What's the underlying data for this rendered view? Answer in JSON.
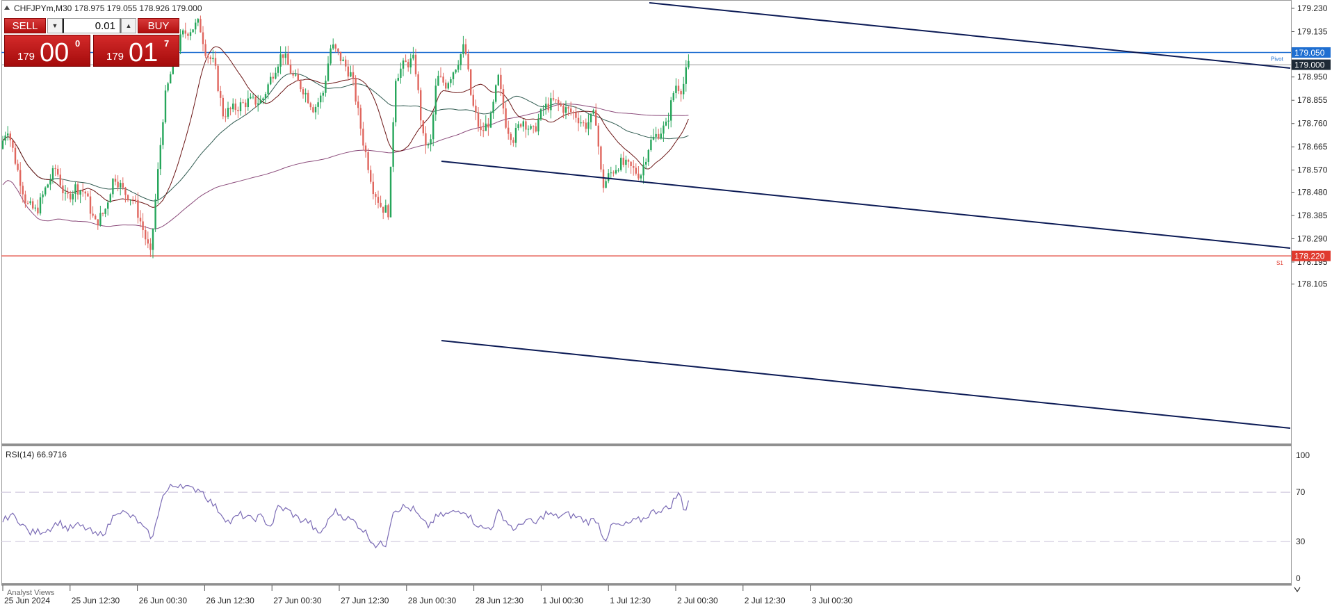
{
  "header": {
    "symbol_tf": "CHFJPYm,M30",
    "ohlc": "178.975 179.055 178.926 179.000"
  },
  "trade_panel": {
    "sell_label": "SELL",
    "buy_label": "BUY",
    "lot_value": "0.01",
    "sell_price_prefix": "179",
    "sell_price_main": "00",
    "sell_price_sup": "0",
    "buy_price_prefix": "179",
    "buy_price_main": "01",
    "buy_price_sup": "7"
  },
  "price_axis": {
    "ticks": [
      "179.230",
      "179.135",
      "178.950",
      "178.855",
      "178.760",
      "178.665",
      "178.570",
      "178.480",
      "178.385",
      "178.290",
      "178.195",
      "178.105"
    ],
    "tick_values": [
      179.23,
      179.135,
      178.95,
      178.855,
      178.76,
      178.665,
      178.57,
      178.48,
      178.385,
      178.29,
      178.195,
      178.105
    ],
    "pivot_label": "179.050",
    "pivot_text": "Pivot",
    "current_label": "179.000",
    "s1_label": "178.220",
    "s1_text": "S1",
    "pivot_color": "#1f6fd1",
    "s1_color": "#e03a2e",
    "current_bg": "#1e2a36"
  },
  "rsi": {
    "label": "RSI(14) 66.9716",
    "levels": [
      "100",
      "70",
      "30",
      "0"
    ],
    "line_color": "#7b6bb5"
  },
  "time_axis": {
    "labels": [
      "25 Jun 2024",
      "25 Jun 12:30",
      "26 Jun 00:30",
      "26 Jun 12:30",
      "27 Jun 00:30",
      "27 Jun 12:30",
      "28 Jun 00:30",
      "28 Jun 12:30",
      "1 Jul 00:30",
      "1 Jul 12:30",
      "2 Jul 00:30",
      "2 Jul 12:30",
      "3 Jul 00:30"
    ]
  },
  "bottom_tab": "Analyst Views",
  "colors": {
    "bull": "#26a65b",
    "bear": "#e0665e",
    "channel": "#0b1a55",
    "ma_fast": "#6b1515",
    "ma_mid": "#2f5a50",
    "ma_slow": "#8a4a7a"
  },
  "chart_data": {
    "type": "candlestick",
    "instrument": "CHFJPYm",
    "timeframe": "M30",
    "ylim": [
      178.08,
      179.25
    ],
    "close_path": [
      [
        0,
        178.62
      ],
      [
        14,
        178.75
      ],
      [
        28,
        178.58
      ],
      [
        42,
        178.43
      ],
      [
        56,
        178.4
      ],
      [
        70,
        178.5
      ],
      [
        84,
        178.58
      ],
      [
        98,
        178.45
      ],
      [
        112,
        178.5
      ],
      [
        126,
        178.48
      ],
      [
        140,
        178.35
      ],
      [
        154,
        178.4
      ],
      [
        168,
        178.55
      ],
      [
        182,
        178.48
      ],
      [
        196,
        178.45
      ],
      [
        210,
        178.32
      ],
      [
        220,
        178.22
      ],
      [
        232,
        178.6
      ],
      [
        240,
        178.85
      ],
      [
        252,
        179.0
      ],
      [
        265,
        179.12
      ],
      [
        280,
        179.15
      ],
      [
        290,
        179.17
      ],
      [
        300,
        179.05
      ],
      [
        312,
        179.0
      ],
      [
        324,
        178.8
      ],
      [
        340,
        178.82
      ],
      [
        360,
        178.85
      ],
      [
        380,
        178.85
      ],
      [
        398,
        178.98
      ],
      [
        410,
        179.05
      ],
      [
        425,
        178.95
      ],
      [
        440,
        178.9
      ],
      [
        455,
        178.82
      ],
      [
        468,
        178.88
      ],
      [
        480,
        179.08
      ],
      [
        495,
        179.02
      ],
      [
        510,
        178.95
      ],
      [
        525,
        178.7
      ],
      [
        540,
        178.5
      ],
      [
        552,
        178.42
      ],
      [
        563,
        178.4
      ],
      [
        572,
        178.95
      ],
      [
        585,
        179.0
      ],
      [
        600,
        179.02
      ],
      [
        612,
        178.7
      ],
      [
        622,
        178.65
      ],
      [
        632,
        178.95
      ],
      [
        645,
        178.92
      ],
      [
        660,
        179.0
      ],
      [
        672,
        179.08
      ],
      [
        682,
        178.85
      ],
      [
        695,
        178.72
      ],
      [
        710,
        178.78
      ],
      [
        720,
        178.95
      ],
      [
        732,
        178.75
      ],
      [
        742,
        178.7
      ],
      [
        755,
        178.78
      ],
      [
        770,
        178.72
      ],
      [
        785,
        178.82
      ],
      [
        800,
        178.85
      ],
      [
        815,
        178.82
      ],
      [
        830,
        178.8
      ],
      [
        845,
        178.75
      ],
      [
        860,
        178.8
      ],
      [
        870,
        178.5
      ],
      [
        880,
        178.55
      ],
      [
        895,
        178.6
      ],
      [
        910,
        178.58
      ],
      [
        925,
        178.55
      ],
      [
        938,
        178.68
      ],
      [
        950,
        178.72
      ],
      [
        962,
        178.75
      ],
      [
        975,
        178.92
      ],
      [
        985,
        178.9
      ],
      [
        993,
        179.0
      ]
    ],
    "pivot": 179.05,
    "s1": 178.22,
    "current_price": 179.0,
    "rsi": {
      "ylim": [
        0,
        100
      ],
      "levels": [
        70,
        30
      ],
      "path": [
        [
          0,
          43
        ],
        [
          14,
          52
        ],
        [
          28,
          47
        ],
        [
          42,
          37
        ],
        [
          56,
          38
        ],
        [
          70,
          40
        ],
        [
          84,
          46
        ],
        [
          98,
          40
        ],
        [
          112,
          43
        ],
        [
          126,
          40
        ],
        [
          140,
          34
        ],
        [
          154,
          40
        ],
        [
          168,
          56
        ],
        [
          182,
          52
        ],
        [
          196,
          48
        ],
        [
          210,
          38
        ],
        [
          220,
          33
        ],
        [
          232,
          65
        ],
        [
          245,
          74
        ],
        [
          260,
          77
        ],
        [
          275,
          72
        ],
        [
          288,
          73
        ],
        [
          300,
          64
        ],
        [
          315,
          55
        ],
        [
          330,
          45
        ],
        [
          345,
          52
        ],
        [
          360,
          48
        ],
        [
          375,
          50
        ],
        [
          390,
          42
        ],
        [
          400,
          58
        ],
        [
          415,
          55
        ],
        [
          430,
          48
        ],
        [
          445,
          46
        ],
        [
          458,
          35
        ],
        [
          470,
          44
        ],
        [
          480,
          55
        ],
        [
          495,
          50
        ],
        [
          510,
          46
        ],
        [
          525,
          38
        ],
        [
          540,
          27
        ],
        [
          555,
          28
        ],
        [
          565,
          55
        ],
        [
          580,
          58
        ],
        [
          595,
          56
        ],
        [
          605,
          48
        ],
        [
          615,
          42
        ],
        [
          628,
          50
        ],
        [
          642,
          52
        ],
        [
          655,
          54
        ],
        [
          668,
          56
        ],
        [
          680,
          47
        ],
        [
          695,
          40
        ],
        [
          708,
          42
        ],
        [
          718,
          55
        ],
        [
          730,
          45
        ],
        [
          742,
          39
        ],
        [
          755,
          48
        ],
        [
          770,
          44
        ],
        [
          785,
          53
        ],
        [
          800,
          50
        ],
        [
          815,
          52
        ],
        [
          830,
          50
        ],
        [
          845,
          46
        ],
        [
          858,
          48
        ],
        [
          870,
          31
        ],
        [
          882,
          44
        ],
        [
          895,
          42
        ],
        [
          910,
          46
        ],
        [
          925,
          48
        ],
        [
          935,
          53
        ],
        [
          950,
          56
        ],
        [
          962,
          57
        ],
        [
          972,
          66
        ],
        [
          978,
          69
        ],
        [
          985,
          54
        ],
        [
          993,
          67
        ]
      ]
    }
  }
}
